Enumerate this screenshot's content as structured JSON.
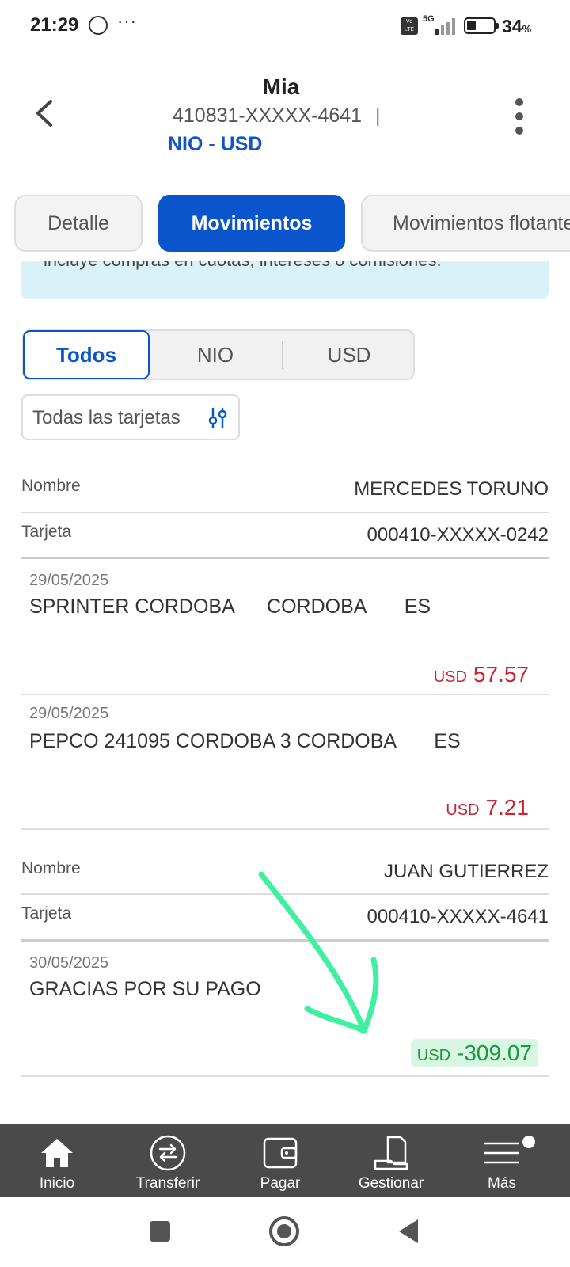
{
  "status_bar": {
    "time": "21:29",
    "dots": "···",
    "network": "5G",
    "volte": "Vo LTE",
    "battery_pct": "34",
    "battery_unit": "%"
  },
  "header": {
    "title": "Mia",
    "account": "410831-XXXXX-4641",
    "separator": "|",
    "currency": "NIO - USD"
  },
  "tabs": [
    {
      "label": "Detalle",
      "active": false
    },
    {
      "label": "Movimientos",
      "active": true
    },
    {
      "label": "Movimientos flotantes",
      "active": false
    }
  ],
  "banner": {
    "text": "incluye compras en cuotas, intereses o comisiones."
  },
  "currency_filter": {
    "options": [
      "Todos",
      "NIO",
      "USD"
    ],
    "selected": "Todos"
  },
  "card_filter": {
    "label": "Todas las tarjetas"
  },
  "groups": [
    {
      "name_label": "Nombre",
      "name": "MERCEDES TORUNO",
      "card_label": "Tarjeta",
      "card": "000410-XXXXX-0242",
      "transactions": [
        {
          "date": "29/05/2025",
          "description": "SPRINTER CORDOBA      CORDOBA       ES",
          "currency": "USD",
          "amount": "57.57"
        },
        {
          "date": "29/05/2025",
          "description": "PEPCO 241095 CORDOBA 3 CORDOBA       ES",
          "currency": "USD",
          "amount": "7.21"
        }
      ]
    },
    {
      "name_label": "Nombre",
      "name": "JUAN GUTIERREZ",
      "card_label": "Tarjeta",
      "card": "000410-XXXXX-4641",
      "transactions": [
        {
          "date": "30/05/2025",
          "description": "GRACIAS POR SU PAGO",
          "currency": "USD",
          "amount": "-309.07"
        }
      ]
    }
  ],
  "bottom_nav": [
    {
      "label": "Inicio",
      "icon": "home-icon"
    },
    {
      "label": "Transferir",
      "icon": "transfer-icon"
    },
    {
      "label": "Pagar",
      "icon": "wallet-icon"
    },
    {
      "label": "Gestionar",
      "icon": "manage-icon"
    },
    {
      "label": "Más",
      "icon": "menu-icon"
    }
  ],
  "colors": {
    "primary": "#0a55cc",
    "debit": "#cc2233",
    "credit": "#1a9a3b",
    "annotation": "#3ef0a0"
  }
}
